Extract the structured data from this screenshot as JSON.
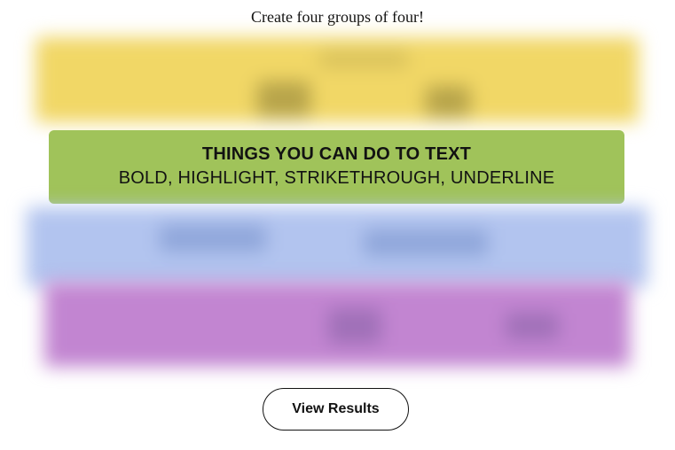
{
  "prompt": "Create four groups of four!",
  "solved_group": {
    "title": "THINGS YOU CAN DO TO TEXT",
    "members": "BOLD, HIGHLIGHT, STRIKETHROUGH, UNDERLINE",
    "color": "#a0c35a"
  },
  "hidden_groups": [
    {
      "color": "#f1d766"
    },
    {
      "color": "#b2c4ef"
    },
    {
      "color": "#c285d1"
    }
  ],
  "results_button": {
    "label": "View Results"
  }
}
